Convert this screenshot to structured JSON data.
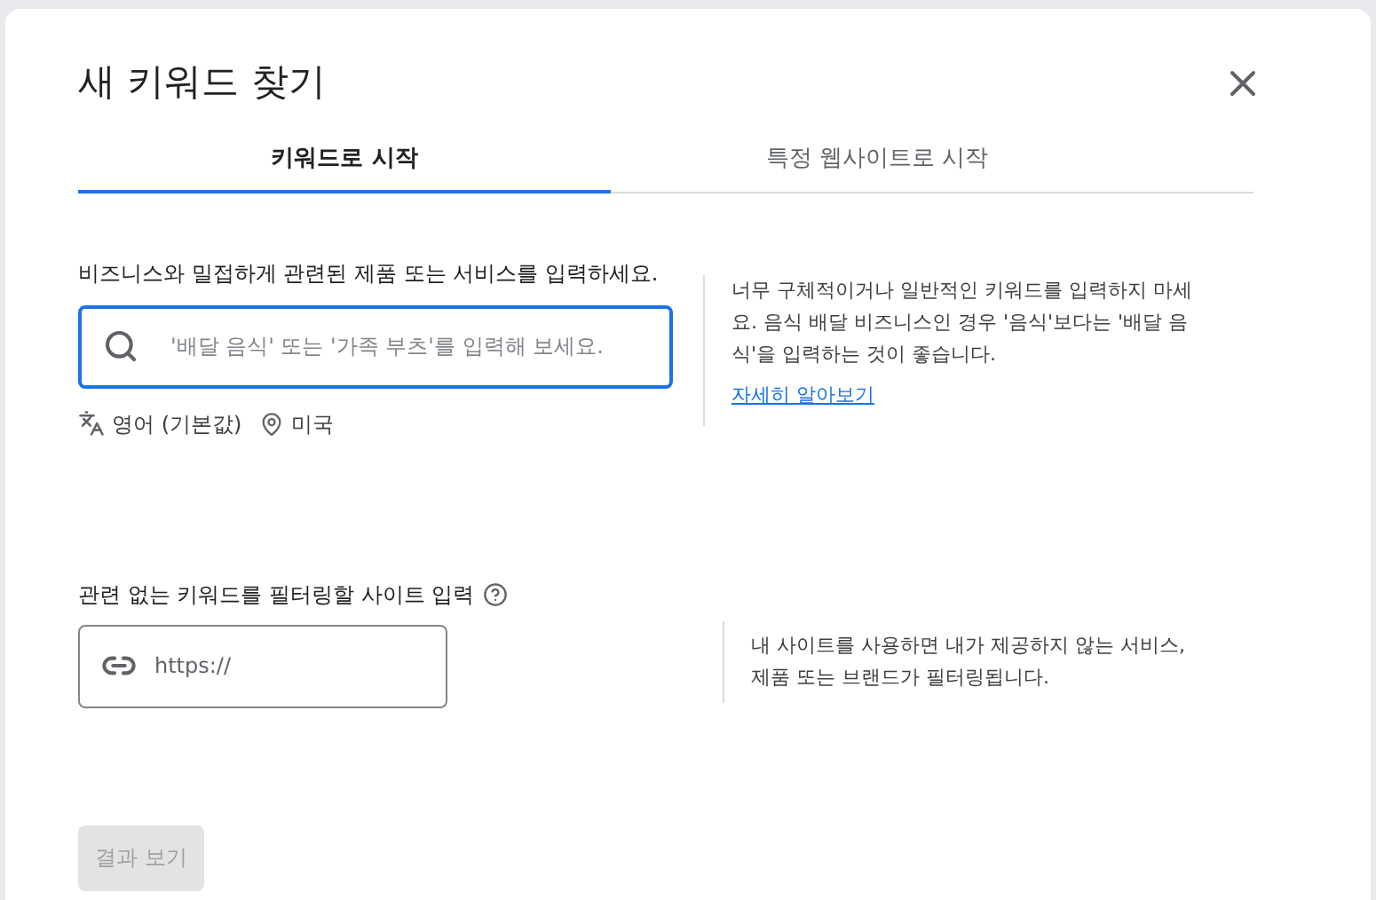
{
  "dialog": {
    "title": "새 키워드 찾기"
  },
  "tabs": [
    {
      "label": "키워드로 시작",
      "selected": true
    },
    {
      "label": "특정 웹사이트로 시작",
      "selected": false
    }
  ],
  "keyword_section": {
    "label": "비즈니스와 밀접하게 관련된 제품 또는 서비스를 입력하세요.",
    "field": {
      "placeholder": "'배달 음식' 또는 '가족 부츠'를 입력해 보세요.",
      "focused": true
    },
    "language": "영어 (기본값)",
    "location": "미국",
    "hint": "너무 구체적이거나 일반적인 키워드를 입력하지 마세요. 음식 배달 비즈니스인 경우 '음식'보다는 '배달 음식'을 입력하는 것이 좋습니다.",
    "link": "자세히 알아보기"
  },
  "site_section": {
    "label": "관련 없는 키워드를 필터링할 사이트 입력",
    "field": {
      "placeholder": "https://"
    },
    "hint": "내 사이트를 사용하면 내가 제공하지 않는 서비스, 제품 또는 브랜드가 필터링됩니다."
  },
  "submit_button": {
    "label": "결과 보기",
    "disabled": true
  }
}
